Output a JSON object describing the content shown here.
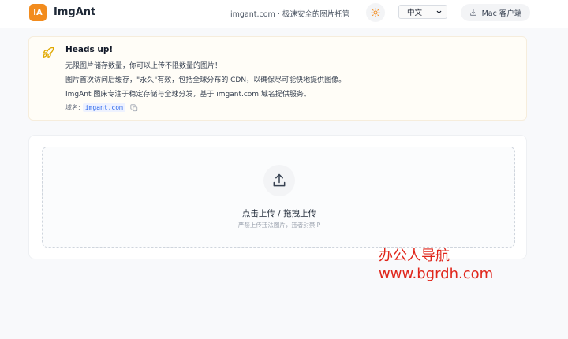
{
  "header": {
    "logo_text": "IA",
    "brand": "ImgAnt",
    "tagline": "imgant.com · 极速安全的图片托管",
    "theme_icon": "sun-icon",
    "language": "中文",
    "mac_button": "Mac 客户端"
  },
  "alert": {
    "title": "Heads up!",
    "lines": [
      "无限图片储存数量，你可以上传不限数量的图片！",
      "图片首次访问后缓存，\"永久\"有效，包括全球分布的 CDN，以确保尽可能快地提供图像。",
      "ImgAnt 图床专注于稳定存储与全球分发，基于 imgant.com 域名提供服务。"
    ],
    "domain_label": "域名:",
    "domain_value": "imgant.com"
  },
  "upload": {
    "title": "点击上传 / 拖拽上传",
    "subtitle": "严禁上传违法图片，违者封禁IP"
  },
  "watermark": {
    "line1": "办公人导航",
    "line2": "www.bgrdh.com"
  },
  "colors": {
    "accent": "#f28c1e",
    "link": "#2563eb",
    "watermark": "#e0261b"
  }
}
